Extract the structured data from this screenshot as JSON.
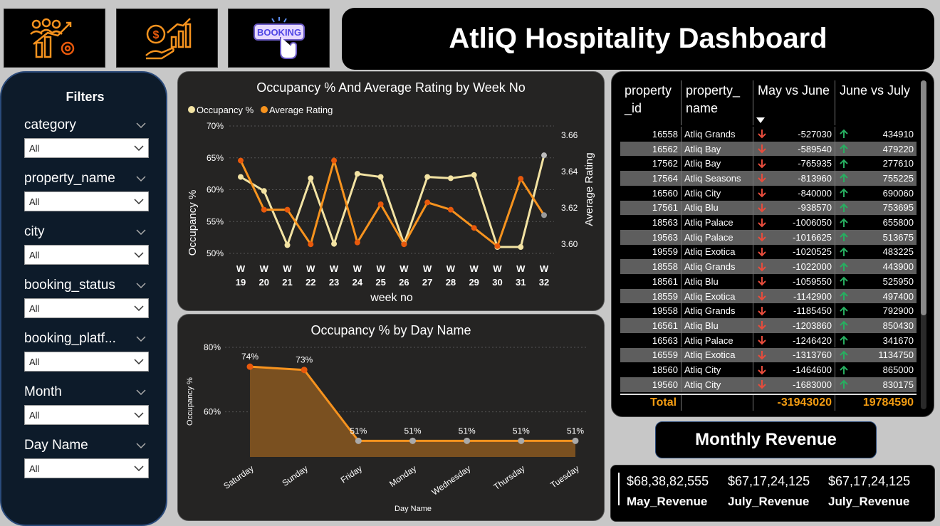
{
  "header": {
    "title": "AtliQ Hospitality Dashboard",
    "icons": [
      {
        "name": "analytics-people-icon"
      },
      {
        "name": "revenue-growth-icon"
      },
      {
        "name": "booking-button-icon",
        "label": "BOOKING"
      }
    ]
  },
  "filters": {
    "title": "Filters",
    "items": [
      {
        "label": "category",
        "value": "All"
      },
      {
        "label": "property_name",
        "value": "All"
      },
      {
        "label": "city",
        "value": "All"
      },
      {
        "label": "booking_status",
        "value": "All"
      },
      {
        "label": "booking_platf...",
        "value": "All"
      },
      {
        "label": "Month",
        "value": "All"
      },
      {
        "label": "Day Name",
        "value": "All"
      }
    ]
  },
  "weekly_chart": {
    "title": "Occupancy % And Average Rating by Week No",
    "legend": [
      "Occupancy %",
      "Average Rating"
    ],
    "y_left_label": "Occupancy %",
    "y_right_label": "Average Rating",
    "x_label": "week no",
    "colors": {
      "occupancy": "#f3e3a3",
      "rating": "#f7931e"
    }
  },
  "day_chart": {
    "title": "Occupancy % by Day Name",
    "y_label": "Occupancy %",
    "x_label": "Day Name",
    "colors": {
      "line": "#f7931e",
      "area": "#7a5020"
    }
  },
  "chart_data": [
    {
      "type": "line",
      "title": "Occupancy % And Average Rating by Week No",
      "x": [
        "W 19",
        "W 20",
        "W 21",
        "W 22",
        "W 23",
        "W 24",
        "W 25",
        "W 26",
        "W 27",
        "W 28",
        "W 29",
        "W 30",
        "W 31",
        "W 32"
      ],
      "xlabel": "week no",
      "ylabel": "Occupancy %",
      "ylabel_right": "Average Rating",
      "ylim": [
        50,
        70
      ],
      "yticks": [
        "50%",
        "55%",
        "60%",
        "65%",
        "70%"
      ],
      "ylim_right": [
        3.595,
        3.665
      ],
      "yticks_right": [
        "3.60",
        "3.62",
        "3.64",
        "3.66"
      ],
      "series": [
        {
          "name": "Occupancy %",
          "axis": "left",
          "values": [
            62.0,
            59.8,
            51.3,
            61.8,
            51.5,
            62.5,
            62.0,
            51.5,
            62.0,
            61.8,
            62.3,
            51.0,
            51.0,
            65.4
          ]
        },
        {
          "name": "Average Rating",
          "axis": "right",
          "values": [
            3.646,
            3.619,
            3.619,
            3.6,
            3.646,
            3.601,
            3.622,
            3.6,
            3.623,
            3.619,
            3.609,
            3.599,
            3.636,
            3.616
          ]
        }
      ],
      "legend": "top-left",
      "grid": true
    },
    {
      "type": "area",
      "title": "Occupancy % by Day Name",
      "categories": [
        "Saturday",
        "Sunday",
        "Friday",
        "Monday",
        "Wednesday",
        "Thursday",
        "Tuesday"
      ],
      "values": [
        74,
        73,
        51,
        51,
        51,
        51,
        51
      ],
      "data_labels": [
        "74%",
        "73%",
        "51%",
        "51%",
        "51%",
        "51%",
        "51%"
      ],
      "xlabel": "Day Name",
      "ylabel": "Occupancy %",
      "ylim": [
        46,
        80
      ],
      "yticks": [
        "60%",
        "80%"
      ],
      "grid": true
    }
  ],
  "table": {
    "headers": [
      "property\n_id",
      "property_\nname",
      "May vs June",
      "June vs July"
    ],
    "rows": [
      [
        "16558",
        "Atliq Grands",
        "-527030",
        "434910"
      ],
      [
        "16562",
        "Atliq Bay",
        "-589540",
        "479220"
      ],
      [
        "17562",
        "Atliq Bay",
        "-765935",
        "277610"
      ],
      [
        "17564",
        "Atliq Seasons",
        "-813960",
        "755225"
      ],
      [
        "16560",
        "Atliq City",
        "-840000",
        "690060"
      ],
      [
        "17561",
        "Atliq Blu",
        "-938570",
        "753695"
      ],
      [
        "18563",
        "Atliq Palace",
        "-1006050",
        "655800"
      ],
      [
        "19563",
        "Atliq Palace",
        "-1016625",
        "513675"
      ],
      [
        "19559",
        "Atliq Exotica",
        "-1020525",
        "483225"
      ],
      [
        "18558",
        "Atliq Grands",
        "-1022000",
        "443900"
      ],
      [
        "18561",
        "Atliq Blu",
        "-1059550",
        "525950"
      ],
      [
        "18559",
        "Atliq Exotica",
        "-1142900",
        "497400"
      ],
      [
        "19558",
        "Atliq Grands",
        "-1185450",
        "792900"
      ],
      [
        "16561",
        "Atliq Blu",
        "-1203860",
        "850430"
      ],
      [
        "16563",
        "Atliq Palace",
        "-1246420",
        "341670"
      ],
      [
        "16559",
        "Atliq Exotica",
        "-1313760",
        "1134750"
      ],
      [
        "18560",
        "Atliq City",
        "-1464600",
        "865000"
      ],
      [
        "19560",
        "Atliq City",
        "-1683000",
        "830175"
      ]
    ],
    "total": {
      "label": "Total",
      "may_vs_june": "-31943020",
      "june_vs_july": "19784590"
    },
    "colors": {
      "down": "#e74c3c",
      "up": "#27ae60",
      "total": "#f39c12"
    }
  },
  "monthly_revenue": {
    "title": "Monthly Revenue",
    "cards": [
      {
        "value": "$68,38,82,555",
        "label": "May_Revenue"
      },
      {
        "value": "$67,17,24,125",
        "label": "July_Revenue"
      },
      {
        "value": "$67,17,24,125",
        "label": "July_Revenue"
      }
    ]
  }
}
